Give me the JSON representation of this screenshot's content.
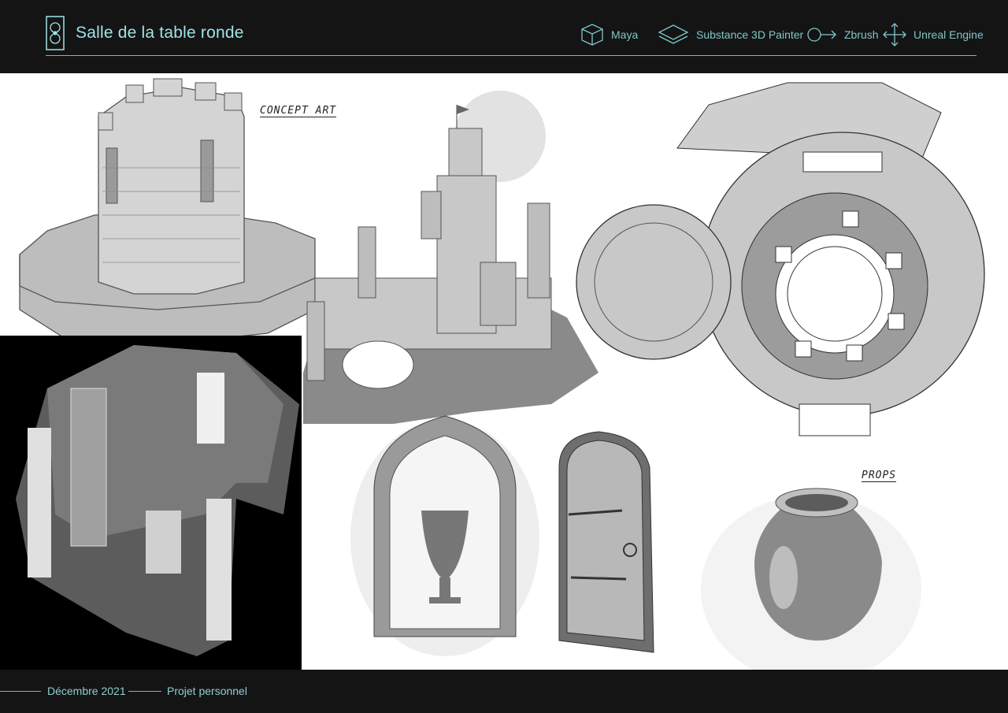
{
  "header": {
    "title": "Salle de la table ronde",
    "tools": [
      {
        "label": "Maya",
        "icon": "cube-icon"
      },
      {
        "label": "Substance 3D Painter",
        "icon": "layers-icon"
      },
      {
        "label": "Zbrush",
        "icon": "stroke-arrow-icon"
      },
      {
        "label": "Unreal Engine",
        "icon": "move-arrows-icon"
      }
    ]
  },
  "artboard": {
    "concept_label": "CONCEPT ART",
    "props_label": "PROPS"
  },
  "footer": {
    "date": "Décembre 2021",
    "project": "Projet personnel"
  },
  "colors": {
    "background": "#141414",
    "accent": "#9fe3e6",
    "line": "#7fb5b8"
  }
}
